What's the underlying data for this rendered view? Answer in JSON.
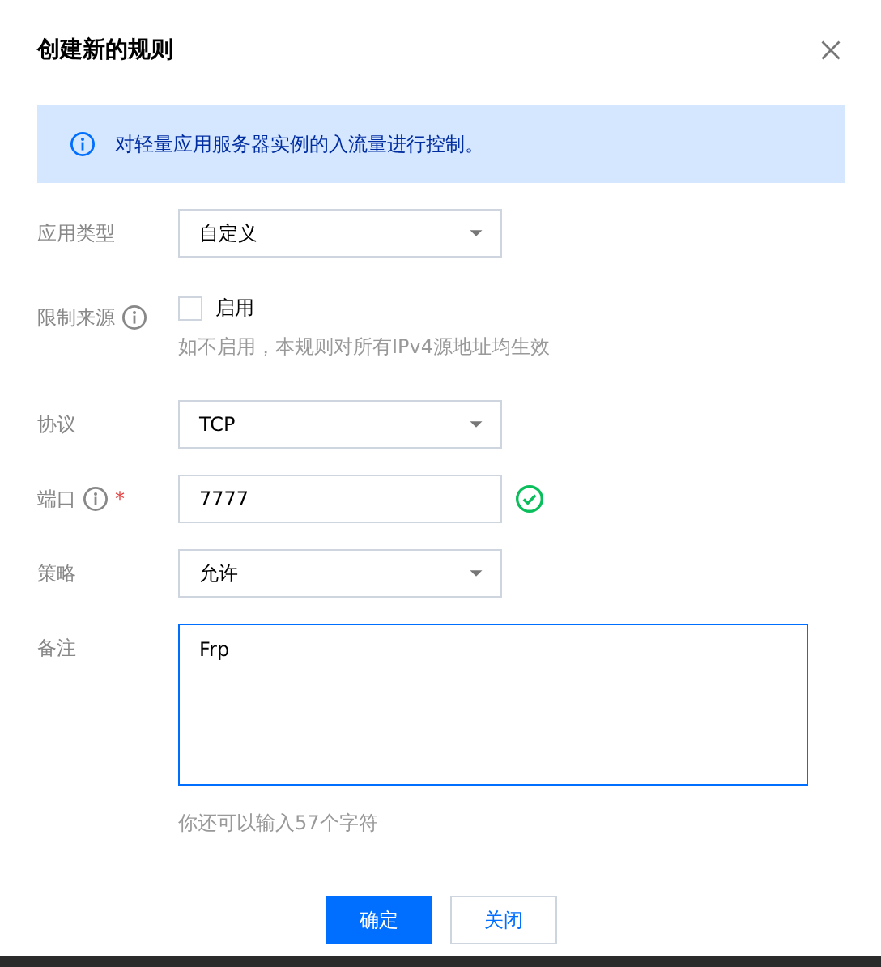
{
  "dialog": {
    "title": "创建新的规则"
  },
  "notice": {
    "text": "对轻量应用服务器实例的入流量进行控制。"
  },
  "fields": [
    {
      "kind": "select",
      "label": "应用类型",
      "info": false,
      "required": false,
      "value": "自定义"
    },
    {
      "kind": "checkbox",
      "label": "限制来源",
      "info": true,
      "required": false,
      "option": "启用",
      "checked": false,
      "hint": "如不启用，本规则对所有IPv4源地址均生效"
    },
    {
      "kind": "select",
      "label": "协议",
      "info": false,
      "required": false,
      "value": "TCP"
    },
    {
      "kind": "input",
      "label": "端口",
      "info": true,
      "required": true,
      "required_mark": "*",
      "value": "7777",
      "valid": true
    },
    {
      "kind": "select",
      "label": "策略",
      "info": false,
      "required": false,
      "value": "允许"
    },
    {
      "kind": "textarea",
      "label": "备注",
      "info": false,
      "required": false,
      "value": "Frp",
      "focused": true,
      "hint": "你还可以输入57个字符"
    }
  ],
  "buttons": [
    {
      "label": "确定",
      "primary": true
    },
    {
      "label": "关闭",
      "primary": false
    }
  ]
}
